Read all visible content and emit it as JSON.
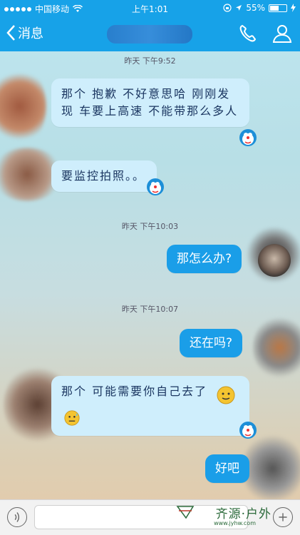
{
  "status_bar": {
    "carrier": "中国移动",
    "time": "上午1:01",
    "battery": "55%",
    "battery_level": 0.55
  },
  "nav": {
    "back_label": "消息",
    "icons": [
      "phone-icon",
      "profile-icon"
    ]
  },
  "messages": [
    {
      "type": "timestamp",
      "text": "昨天 下午9:52"
    },
    {
      "type": "in",
      "text": "那个  抱歉  不好意思哈  刚刚发现  车要上高速  不能带那么多人"
    },
    {
      "type": "in",
      "text": "要监控拍照。。"
    },
    {
      "type": "timestamp",
      "text": "昨天 下午10:03"
    },
    {
      "type": "out",
      "text": "那怎么办?"
    },
    {
      "type": "timestamp",
      "text": "昨天 下午10:07"
    },
    {
      "type": "out",
      "text": "还在吗?"
    },
    {
      "type": "in",
      "text": "那个   可能需要你自己去了"
    },
    {
      "type": "out",
      "text": "好吧"
    }
  ],
  "watermark": {
    "text": "齐源·户外",
    "url": "www.jyhw.com"
  },
  "colors": {
    "accent": "#17a2e8",
    "incoming_bubble": "#cfeefc",
    "outgoing_bubble": "#1a9ee8"
  }
}
